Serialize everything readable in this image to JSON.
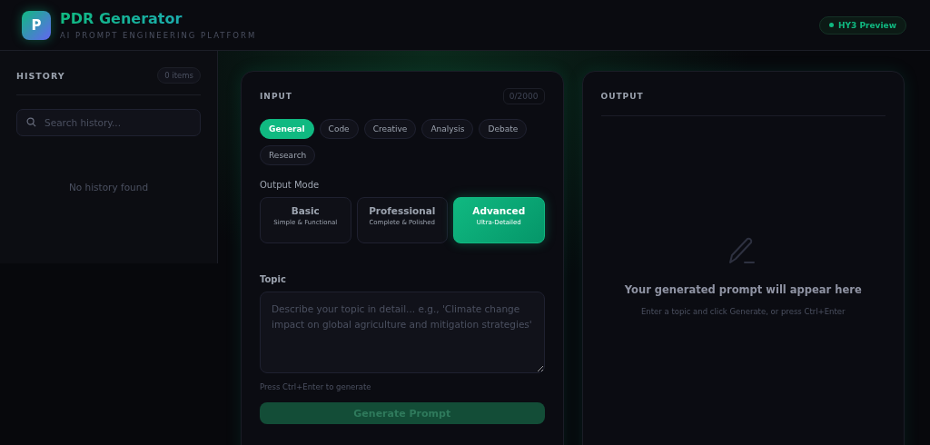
{
  "header": {
    "logo_letter": "P",
    "title": "PDR Generator",
    "subtitle": "AI PROMPT ENGINEERING PLATFORM",
    "badge": "HY3 Preview"
  },
  "history": {
    "title": "HISTORY",
    "count": "0 items",
    "search": {
      "placeholder": "Search history..."
    },
    "empty": "No history found"
  },
  "input": {
    "title": "INPUT",
    "counter": "0/2000",
    "categories": [
      {
        "label": "General",
        "selected": true
      },
      {
        "label": "Code",
        "selected": false
      },
      {
        "label": "Creative",
        "selected": false
      },
      {
        "label": "Analysis",
        "selected": false
      },
      {
        "label": "Debate",
        "selected": false
      },
      {
        "label": "Research",
        "selected": false
      }
    ],
    "mode_label": "Output Mode",
    "modes": [
      {
        "label": "Basic",
        "description": "Simple & Functional",
        "selected": false
      },
      {
        "label": "Professional",
        "description": "Complete & Polished",
        "selected": false
      },
      {
        "label": "Advanced",
        "description": "Ultra-Detailed",
        "selected": true
      }
    ],
    "topic_label": "Topic",
    "topic": {
      "placeholder": "Describe your topic in detail... e.g., 'Climate change impact on global agriculture and mitigation strategies'"
    },
    "hint": "Press Ctrl+Enter to generate",
    "button": "Generate Prompt"
  },
  "output": {
    "title": "OUTPUT",
    "empty_title": "Your generated prompt will appear here",
    "empty_hint": "Enter a topic and click Generate, or press Ctrl+Enter"
  }
}
